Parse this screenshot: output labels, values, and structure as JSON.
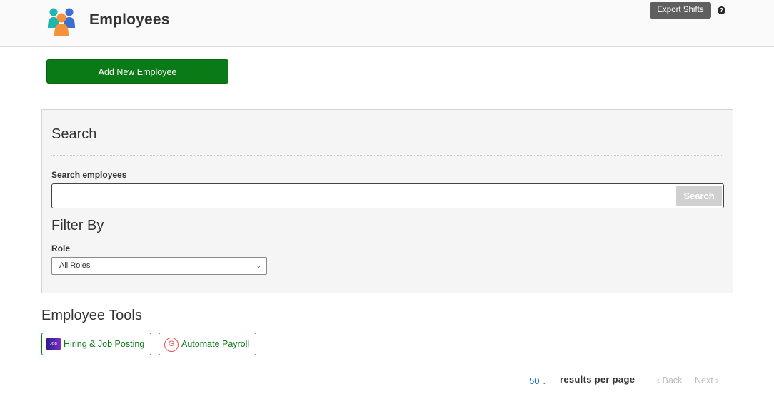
{
  "header": {
    "title": "Employees",
    "logo_icon": "people-group-icon",
    "export_label": "Export Shifts",
    "help_icon": "question-mark-icon",
    "help_glyph": "?"
  },
  "actions": {
    "add_employee_label": "Add New Employee"
  },
  "search_panel": {
    "heading": "Search",
    "search_label": "Search employees",
    "search_value": "",
    "search_button": "Search",
    "filter_heading": "Filter By",
    "role_label": "Role",
    "role_selected": "All Roles"
  },
  "tools": {
    "heading": "Employee Tools",
    "items": [
      {
        "label": "Hiring & Job Posting",
        "icon": "job-board-logo-icon",
        "icon_text": "JOB"
      },
      {
        "label": "Automate Payroll",
        "icon": "payroll-g-icon",
        "icon_text": "G"
      }
    ]
  },
  "pagination": {
    "per_page_value": "50",
    "per_page_label": "results per page",
    "back_label": "Back",
    "next_label": "Next"
  },
  "colors": {
    "primary_green": "#0a7a17",
    "export_button": "#5f5f5f",
    "link_blue": "#1c6fb5",
    "disabled": "#bdbdbd"
  }
}
